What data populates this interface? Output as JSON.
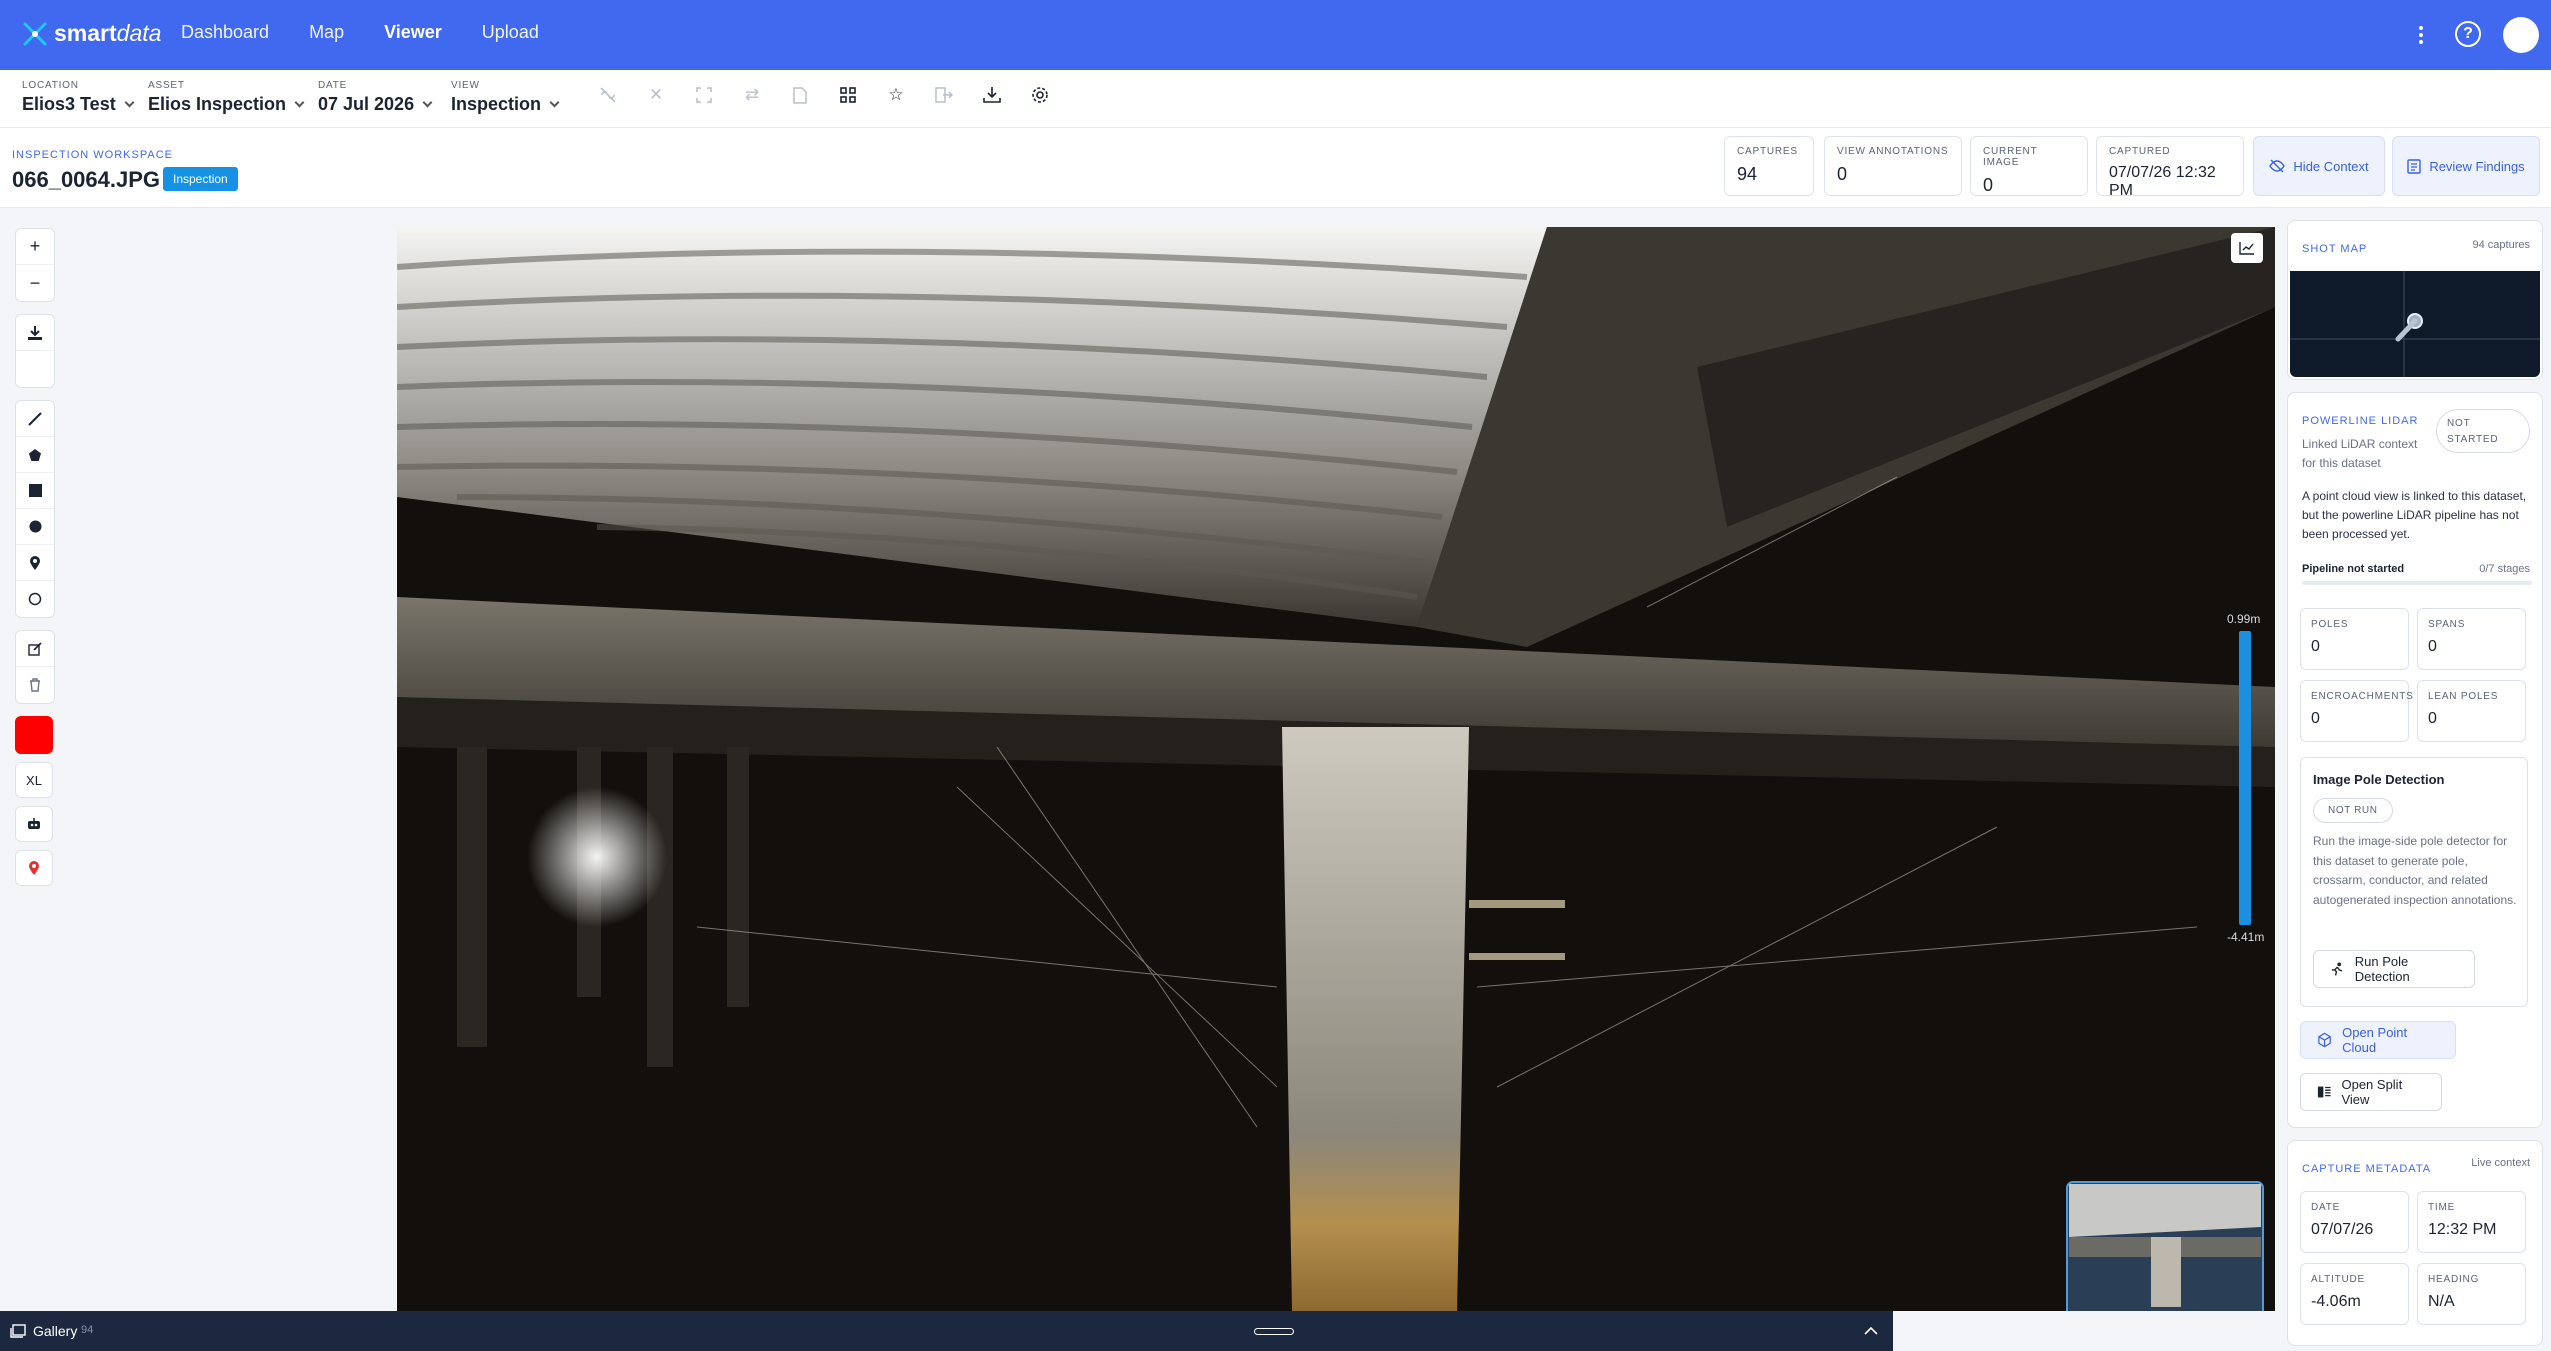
{
  "app": {
    "brand_bold": "smart",
    "brand_light": "data"
  },
  "nav": {
    "items": [
      "Dashboard",
      "Map",
      "Viewer",
      "Upload"
    ],
    "active": "Viewer"
  },
  "filters": {
    "location": {
      "label": "LOCATION",
      "value": "Elios3 Test"
    },
    "asset": {
      "label": "ASSET",
      "value": "Elios Inspection"
    },
    "date": {
      "label": "DATE",
      "value": "07 Jul 2026"
    },
    "view": {
      "label": "VIEW",
      "value": "Inspection"
    }
  },
  "workspace": {
    "label": "INSPECTION WORKSPACE",
    "filename": "066_0064.JPG",
    "badge": "Inspection",
    "stats": [
      {
        "label": "CAPTURES",
        "value": "94"
      },
      {
        "label": "VIEW ANNOTATIONS",
        "value": "0"
      },
      {
        "label": "CURRENT IMAGE",
        "value": "0"
      },
      {
        "label": "CAPTURED",
        "value": "07/07/26 12:32 PM"
      }
    ],
    "hide_context": "Hide Context",
    "review_findings": "Review Findings"
  },
  "tools": {
    "size_label": "XL",
    "color": "#ff0000"
  },
  "viewer": {
    "depth_top": "0.99m",
    "depth_bottom": "-4.41m"
  },
  "shot_map": {
    "title": "SHOT MAP",
    "count": "94 captures"
  },
  "lidar": {
    "title": "POWERLINE LIDAR",
    "subtitle": "Linked LiDAR context for this dataset",
    "status_line1": "NOT",
    "status_line2": "STARTED",
    "description": "A point cloud view is linked to this dataset, but the powerline LiDAR pipeline has not been processed yet.",
    "pipeline_label": "Pipeline not started",
    "pipeline_stages": "0/7 stages",
    "pipeline_progress": 0,
    "stats": [
      {
        "label": "POLES",
        "value": "0"
      },
      {
        "label": "SPANS",
        "value": "0"
      },
      {
        "label": "ENCROACHMENTS",
        "value": "0"
      },
      {
        "label": "LEAN POLES",
        "value": "0"
      }
    ],
    "pole_detection": {
      "title": "Image Pole Detection",
      "status": "NOT RUN",
      "description": "Run the image-side pole detector for this dataset to generate pole, crossarm, conductor, and related autogenerated inspection annotations.",
      "button": "Run Pole Detection"
    },
    "open_point_cloud": "Open Point Cloud",
    "open_split_view": "Open Split View"
  },
  "capture_metadata": {
    "title": "CAPTURE METADATA",
    "tag": "Live context",
    "fields": [
      {
        "label": "DATE",
        "value": "07/07/26"
      },
      {
        "label": "TIME",
        "value": "12:32 PM"
      },
      {
        "label": "ALTITUDE",
        "value": "-4.06m"
      },
      {
        "label": "HEADING",
        "value": "N/A"
      }
    ]
  },
  "gallery": {
    "label": "Gallery",
    "count": "94"
  },
  "colors": {
    "primary": "#4169f0",
    "badge": "#1592e6",
    "gallery_bg": "#1c2740",
    "depth": "#1b8fe0"
  }
}
